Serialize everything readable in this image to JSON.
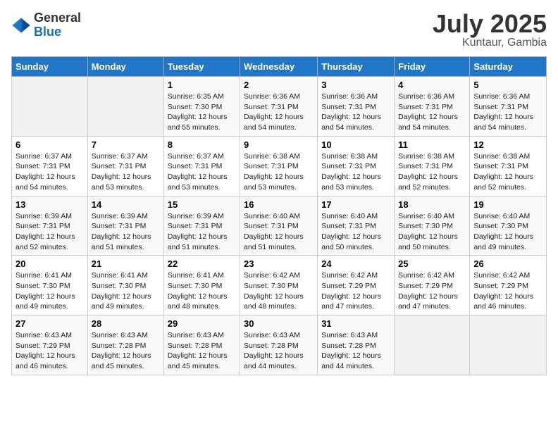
{
  "header": {
    "logo_general": "General",
    "logo_blue": "Blue",
    "month_title": "July 2025",
    "location": "Kuntaur, Gambia"
  },
  "days_of_week": [
    "Sunday",
    "Monday",
    "Tuesday",
    "Wednesday",
    "Thursday",
    "Friday",
    "Saturday"
  ],
  "weeks": [
    [
      {
        "day": "",
        "sunrise": "",
        "sunset": "",
        "daylight": ""
      },
      {
        "day": "",
        "sunrise": "",
        "sunset": "",
        "daylight": ""
      },
      {
        "day": "1",
        "sunrise": "Sunrise: 6:35 AM",
        "sunset": "Sunset: 7:30 PM",
        "daylight": "Daylight: 12 hours and 55 minutes."
      },
      {
        "day": "2",
        "sunrise": "Sunrise: 6:36 AM",
        "sunset": "Sunset: 7:31 PM",
        "daylight": "Daylight: 12 hours and 54 minutes."
      },
      {
        "day": "3",
        "sunrise": "Sunrise: 6:36 AM",
        "sunset": "Sunset: 7:31 PM",
        "daylight": "Daylight: 12 hours and 54 minutes."
      },
      {
        "day": "4",
        "sunrise": "Sunrise: 6:36 AM",
        "sunset": "Sunset: 7:31 PM",
        "daylight": "Daylight: 12 hours and 54 minutes."
      },
      {
        "day": "5",
        "sunrise": "Sunrise: 6:36 AM",
        "sunset": "Sunset: 7:31 PM",
        "daylight": "Daylight: 12 hours and 54 minutes."
      }
    ],
    [
      {
        "day": "6",
        "sunrise": "Sunrise: 6:37 AM",
        "sunset": "Sunset: 7:31 PM",
        "daylight": "Daylight: 12 hours and 54 minutes."
      },
      {
        "day": "7",
        "sunrise": "Sunrise: 6:37 AM",
        "sunset": "Sunset: 7:31 PM",
        "daylight": "Daylight: 12 hours and 53 minutes."
      },
      {
        "day": "8",
        "sunrise": "Sunrise: 6:37 AM",
        "sunset": "Sunset: 7:31 PM",
        "daylight": "Daylight: 12 hours and 53 minutes."
      },
      {
        "day": "9",
        "sunrise": "Sunrise: 6:38 AM",
        "sunset": "Sunset: 7:31 PM",
        "daylight": "Daylight: 12 hours and 53 minutes."
      },
      {
        "day": "10",
        "sunrise": "Sunrise: 6:38 AM",
        "sunset": "Sunset: 7:31 PM",
        "daylight": "Daylight: 12 hours and 53 minutes."
      },
      {
        "day": "11",
        "sunrise": "Sunrise: 6:38 AM",
        "sunset": "Sunset: 7:31 PM",
        "daylight": "Daylight: 12 hours and 52 minutes."
      },
      {
        "day": "12",
        "sunrise": "Sunrise: 6:38 AM",
        "sunset": "Sunset: 7:31 PM",
        "daylight": "Daylight: 12 hours and 52 minutes."
      }
    ],
    [
      {
        "day": "13",
        "sunrise": "Sunrise: 6:39 AM",
        "sunset": "Sunset: 7:31 PM",
        "daylight": "Daylight: 12 hours and 52 minutes."
      },
      {
        "day": "14",
        "sunrise": "Sunrise: 6:39 AM",
        "sunset": "Sunset: 7:31 PM",
        "daylight": "Daylight: 12 hours and 51 minutes."
      },
      {
        "day": "15",
        "sunrise": "Sunrise: 6:39 AM",
        "sunset": "Sunset: 7:31 PM",
        "daylight": "Daylight: 12 hours and 51 minutes."
      },
      {
        "day": "16",
        "sunrise": "Sunrise: 6:40 AM",
        "sunset": "Sunset: 7:31 PM",
        "daylight": "Daylight: 12 hours and 51 minutes."
      },
      {
        "day": "17",
        "sunrise": "Sunrise: 6:40 AM",
        "sunset": "Sunset: 7:31 PM",
        "daylight": "Daylight: 12 hours and 50 minutes."
      },
      {
        "day": "18",
        "sunrise": "Sunrise: 6:40 AM",
        "sunset": "Sunset: 7:30 PM",
        "daylight": "Daylight: 12 hours and 50 minutes."
      },
      {
        "day": "19",
        "sunrise": "Sunrise: 6:40 AM",
        "sunset": "Sunset: 7:30 PM",
        "daylight": "Daylight: 12 hours and 49 minutes."
      }
    ],
    [
      {
        "day": "20",
        "sunrise": "Sunrise: 6:41 AM",
        "sunset": "Sunset: 7:30 PM",
        "daylight": "Daylight: 12 hours and 49 minutes."
      },
      {
        "day": "21",
        "sunrise": "Sunrise: 6:41 AM",
        "sunset": "Sunset: 7:30 PM",
        "daylight": "Daylight: 12 hours and 49 minutes."
      },
      {
        "day": "22",
        "sunrise": "Sunrise: 6:41 AM",
        "sunset": "Sunset: 7:30 PM",
        "daylight": "Daylight: 12 hours and 48 minutes."
      },
      {
        "day": "23",
        "sunrise": "Sunrise: 6:42 AM",
        "sunset": "Sunset: 7:30 PM",
        "daylight": "Daylight: 12 hours and 48 minutes."
      },
      {
        "day": "24",
        "sunrise": "Sunrise: 6:42 AM",
        "sunset": "Sunset: 7:29 PM",
        "daylight": "Daylight: 12 hours and 47 minutes."
      },
      {
        "day": "25",
        "sunrise": "Sunrise: 6:42 AM",
        "sunset": "Sunset: 7:29 PM",
        "daylight": "Daylight: 12 hours and 47 minutes."
      },
      {
        "day": "26",
        "sunrise": "Sunrise: 6:42 AM",
        "sunset": "Sunset: 7:29 PM",
        "daylight": "Daylight: 12 hours and 46 minutes."
      }
    ],
    [
      {
        "day": "27",
        "sunrise": "Sunrise: 6:43 AM",
        "sunset": "Sunset: 7:29 PM",
        "daylight": "Daylight: 12 hours and 46 minutes."
      },
      {
        "day": "28",
        "sunrise": "Sunrise: 6:43 AM",
        "sunset": "Sunset: 7:28 PM",
        "daylight": "Daylight: 12 hours and 45 minutes."
      },
      {
        "day": "29",
        "sunrise": "Sunrise: 6:43 AM",
        "sunset": "Sunset: 7:28 PM",
        "daylight": "Daylight: 12 hours and 45 minutes."
      },
      {
        "day": "30",
        "sunrise": "Sunrise: 6:43 AM",
        "sunset": "Sunset: 7:28 PM",
        "daylight": "Daylight: 12 hours and 44 minutes."
      },
      {
        "day": "31",
        "sunrise": "Sunrise: 6:43 AM",
        "sunset": "Sunset: 7:28 PM",
        "daylight": "Daylight: 12 hours and 44 minutes."
      },
      {
        "day": "",
        "sunrise": "",
        "sunset": "",
        "daylight": ""
      },
      {
        "day": "",
        "sunrise": "",
        "sunset": "",
        "daylight": ""
      }
    ]
  ]
}
